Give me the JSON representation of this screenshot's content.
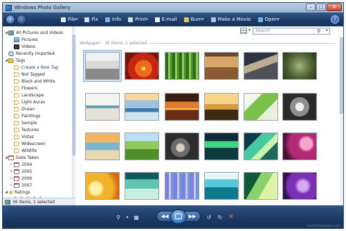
{
  "window": {
    "title": "Windows Photo Gallery",
    "controls": [
      "–",
      "□",
      "X"
    ]
  },
  "menu": {
    "items": [
      {
        "label": "File",
        "icon": "file-icon",
        "color": "#e8eef7",
        "dropdown": true
      },
      {
        "label": "Fix",
        "icon": "fix-icon",
        "color": "#cfe0f5",
        "dropdown": false
      },
      {
        "label": "Info",
        "icon": "info-icon",
        "color": "#7fb2ea",
        "dropdown": false
      },
      {
        "label": "Print",
        "icon": "print-icon",
        "color": "#d8dde4",
        "dropdown": true
      },
      {
        "label": "E-mail",
        "icon": "email-icon",
        "color": "#f3f3f3",
        "dropdown": false
      },
      {
        "label": "Burn",
        "icon": "burn-icon",
        "color": "#e7c75b",
        "dropdown": true
      },
      {
        "label": "Make a Movie",
        "icon": "movie-icon",
        "color": "#b0c4dc",
        "dropdown": false
      },
      {
        "label": "Open",
        "icon": "open-icon",
        "color": "#7ab0e8",
        "dropdown": true
      }
    ],
    "help": "?"
  },
  "sidebar": {
    "items": [
      {
        "label": "All Pictures and Videos",
        "icon": "photos",
        "expander": "◢",
        "indent": 0
      },
      {
        "label": "Pictures",
        "icon": "pic",
        "expander": "",
        "indent": 1
      },
      {
        "label": "Videos",
        "icon": "vid",
        "expander": "",
        "indent": 1
      },
      {
        "label": "Recently Imported",
        "icon": "recent",
        "expander": "",
        "indent": 0
      },
      {
        "label": "Tags",
        "icon": "tag",
        "expander": "◢",
        "indent": 0
      },
      {
        "label": "Create a New Tag",
        "icon": "tagsm",
        "expander": "",
        "indent": 1,
        "italic": true
      },
      {
        "label": "Not Tagged",
        "icon": "tagsm",
        "expander": "",
        "indent": 1
      },
      {
        "label": "Black and White",
        "icon": "tagsm",
        "expander": "",
        "indent": 1
      },
      {
        "label": "Flowers",
        "icon": "tagsm",
        "expander": "",
        "indent": 1
      },
      {
        "label": "Landscape",
        "icon": "tagsm",
        "expander": "",
        "indent": 1
      },
      {
        "label": "Light Auras",
        "icon": "tagsm",
        "expander": "",
        "indent": 1
      },
      {
        "label": "Ocean",
        "icon": "tagsm",
        "expander": "",
        "indent": 1
      },
      {
        "label": "Paintings",
        "icon": "tagsm",
        "expander": "",
        "indent": 1
      },
      {
        "label": "Sample",
        "icon": "tagsm",
        "expander": "",
        "indent": 1
      },
      {
        "label": "Textures",
        "icon": "tagsm",
        "expander": "",
        "indent": 1
      },
      {
        "label": "Vistas",
        "icon": "tagsm",
        "expander": "",
        "indent": 1
      },
      {
        "label": "Widescreen",
        "icon": "tagsm",
        "expander": "",
        "indent": 1
      },
      {
        "label": "Wildlife",
        "icon": "tagsm",
        "expander": "",
        "indent": 1
      },
      {
        "label": "Date Taken",
        "icon": "cal",
        "expander": "◢",
        "indent": 0
      },
      {
        "label": "2004",
        "icon": "cal",
        "expander": "▷",
        "indent": 1
      },
      {
        "label": "2005",
        "icon": "cal",
        "expander": "▷",
        "indent": 1
      },
      {
        "label": "2006",
        "icon": "cal",
        "expander": "▷",
        "indent": 1
      },
      {
        "label": "2007",
        "icon": "cal",
        "expander": "▷",
        "indent": 1
      },
      {
        "label": "Ratings",
        "icon": "star",
        "expander": "◢",
        "indent": 0
      }
    ],
    "rating_rows": [
      5,
      4,
      3,
      2,
      1
    ]
  },
  "search": {
    "placeholder": "Search",
    "icon": "search-icon"
  },
  "gallery": {
    "group_label": "Wallpaper - 36 items, 1 selected",
    "selected_index": 0,
    "thumbnails": [
      {
        "name": "thumb-room",
        "fill": "linear-gradient(#f1f1f1 0 30%, #d9d9d9 30% 60%, #8a8a8a 60% 100%)"
      },
      {
        "name": "thumb-red-flower",
        "fill": "radial-gradient(circle at 55% 60%, #ffd24d 0 8%, #f06a1e 9% 35%, #c4260f 36% 65%, #7a1207 66%)"
      },
      {
        "name": "thumb-bamboo",
        "fill": "repeating-linear-gradient(90deg, #2e6b1e 0 4px, #8dcf52 4px 7px, #4b8f2a 7px 10px)"
      },
      {
        "name": "thumb-rocks",
        "fill": "linear-gradient(#6a4a2c 0 15%, #d8a56b 15% 55%, #8c5a30 55%)"
      },
      {
        "name": "thumb-bridge",
        "fill": "linear-gradient(160deg, #2d3340 0 35%, #bcae93 35% 55%, #4f5059 55%)"
      },
      {
        "name": "thumb-frog",
        "fill": "radial-gradient(circle at 50% 50%, #9bb87a, #4b5e2f 60%, #29321a)"
      },
      {
        "name": "thumb-dragonfly",
        "fill": "linear-gradient(#f3f3f0 0 45%, #5fa3b8 45% 55%, #e4e1d6 55%)"
      },
      {
        "name": "thumb-lake-mountain",
        "fill": "linear-gradient(#f6d7a0 0 25%, #9fc3dd 25% 55%, #3a7ab0 55% 70%, #cfe4f1 70%)"
      },
      {
        "name": "thumb-sunset",
        "fill": "linear-gradient(#3a1c12 0 30%, #e07a2c 30% 55%, #f5c04a 55% 62%, #6a2c14 62%)"
      },
      {
        "name": "thumb-desert-trees",
        "fill": "linear-gradient(#f7d58a 0 40%, #d89a3c 40% 60%, #3e2a13 60%)"
      },
      {
        "name": "thumb-leaf",
        "fill": "linear-gradient(135deg, #f4f7ee 0 30%, #7bc04a 30% 65%, #e9f1dd 65%)"
      },
      {
        "name": "thumb-flower-bw",
        "fill": "radial-gradient(circle at 50% 50%, #f0f0f0 0 20%, #8e8e8e 21% 45%, #2a2a2a 46%)"
      },
      {
        "name": "thumb-beach",
        "fill": "linear-gradient(#f4b562 0 35%, #7ab7cf 35% 65%, #e8d9b0 65%)"
      },
      {
        "name": "thumb-green-hills",
        "fill": "linear-gradient(#b8dff5 0 30%, #8dca5a 30% 60%, #4f8f2b 60%)"
      },
      {
        "name": "thumb-pebbles",
        "fill": "radial-gradient(circle at 45% 55%, #d8cdbd 0 18%, #6b6b6b 19% 40%, #2d2d2d 41%)"
      },
      {
        "name": "thumb-aurora",
        "fill": "linear-gradient(#0f2a3a 0 30%, #3fd68c 30% 55%, #0c3a3f 55%)"
      },
      {
        "name": "thumb-green-curve",
        "fill": "linear-gradient(135deg, #0d3b4a 0 30%, #47c9a0 30% 55%, #c9f2ae 55% 70%, #1b6a5a 70%)"
      },
      {
        "name": "thumb-pink-glow",
        "fill": "radial-gradient(circle at 70% 40%, #f7a5c9 0 20%, #b02a76 30% 60%, #4a0f33 80%)"
      },
      {
        "name": "thumb-yellow-aura",
        "fill": "radial-gradient(circle at 30% 60%, #fff2a6 0 20%, #f2b32a 30% 60%, #d86a12 80%)"
      },
      {
        "name": "thumb-teal-aura",
        "fill": "linear-gradient(#0f5a5a 0 25%, #5fc6b1 25% 60%, #c7efe1 60%)"
      },
      {
        "name": "thumb-violet-stripes",
        "fill": "repeating-linear-gradient(90deg, #7d7ee0 0 5px, #c9c6f4 5px 8px, #6a9ad4 8px 12px)"
      },
      {
        "name": "thumb-water",
        "fill": "linear-gradient(#e9f6f9 0 25%, #58c7d8 25% 55%, #0f7a8e 55%)"
      },
      {
        "name": "thumb-green-wave",
        "fill": "linear-gradient(120deg, #0f5a3a 0 35%, #8ed06a 35% 60%, #dff3a8 60%)"
      },
      {
        "name": "thumb-purple-aura",
        "fill": "radial-gradient(circle at 60% 50%, #d9a8f3 0 20%, #7a2fb4 35% 65%, #2d0f4a 80%)"
      }
    ]
  },
  "status": {
    "count_text": "36 items, 1 selected"
  },
  "bottombar": {
    "controls": [
      "zoom-icon",
      "thumbnail-view-icon",
      "previous-icon",
      "slideshow-icon",
      "next-icon",
      "rotate-left-icon",
      "rotate-right-icon",
      "delete-icon"
    ],
    "watermark": "mostdownload.com"
  }
}
